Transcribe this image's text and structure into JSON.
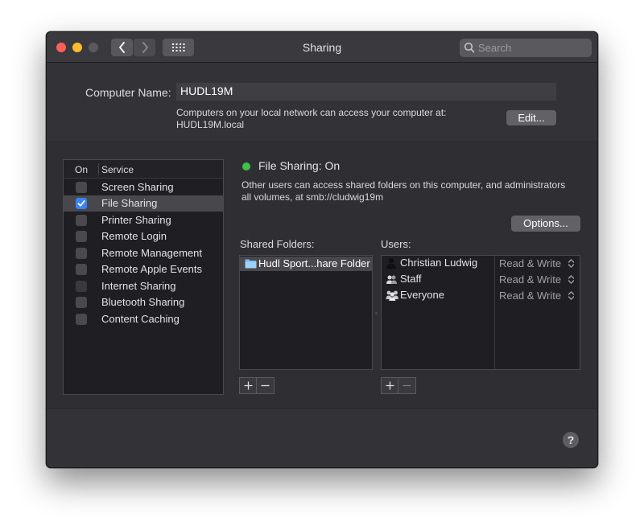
{
  "window": {
    "title": "Sharing",
    "search_placeholder": "Search"
  },
  "computer_name": {
    "label": "Computer Name:",
    "value": "HUDL19M",
    "info_line1": "Computers on your local network can access your computer at:",
    "info_line2": "HUDL19M.local",
    "edit_button": "Edit..."
  },
  "services": {
    "header_on": "On",
    "header_service": "Service",
    "items": [
      {
        "label": "Screen Sharing",
        "checked": false,
        "selected": false
      },
      {
        "label": "File Sharing",
        "checked": true,
        "selected": true
      },
      {
        "label": "Printer Sharing",
        "checked": false,
        "selected": false
      },
      {
        "label": "Remote Login",
        "checked": false,
        "selected": false
      },
      {
        "label": "Remote Management",
        "checked": false,
        "selected": false
      },
      {
        "label": "Remote Apple Events",
        "checked": false,
        "selected": false
      },
      {
        "label": "Internet Sharing",
        "checked": false,
        "selected": false,
        "dimmed": true
      },
      {
        "label": "Bluetooth Sharing",
        "checked": false,
        "selected": false
      },
      {
        "label": "Content Caching",
        "checked": false,
        "selected": false
      }
    ]
  },
  "detail": {
    "status": "File Sharing: On",
    "status_color": "#3fc04a",
    "description_line1": "Other users can access shared folders on this computer, and administrators",
    "description_line2": "all volumes, at smb://cludwig19m",
    "options_button": "Options...",
    "shared_folders_label": "Shared Folders:",
    "users_label": "Users:",
    "shared_folders": [
      {
        "name": "Hudl Sport...hare Folder",
        "icon": "folder-icon"
      }
    ],
    "users": [
      {
        "name": "Christian Ludwig",
        "permission": "Read & Write",
        "icon": "single-user-icon"
      },
      {
        "name": "Staff",
        "permission": "Read & Write",
        "icon": "group-icon"
      },
      {
        "name": "Everyone",
        "permission": "Read & Write",
        "icon": "everyone-icon"
      }
    ],
    "add_symbol": "+",
    "remove_symbol": "−"
  },
  "help_symbol": "?",
  "colors": {
    "accent": "#3a82f7",
    "close": "#fe5f57",
    "minimize": "#febc2e"
  }
}
